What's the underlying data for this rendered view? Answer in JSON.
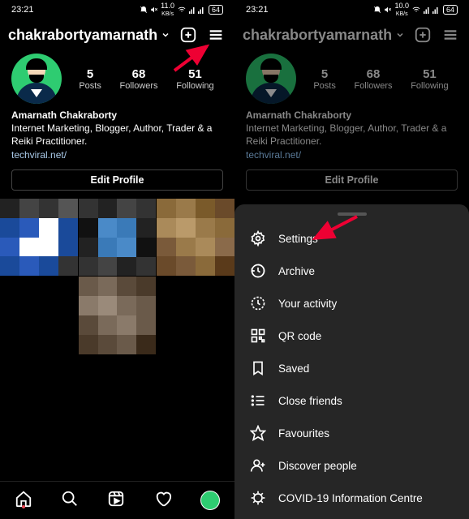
{
  "status": {
    "time": "23:21",
    "battery": "64",
    "net1": "11.0",
    "net2": "10.0",
    "unit": "KB/s"
  },
  "profile": {
    "username": "chakrabortyamarnath",
    "display_name": "Amarnath Chakraborty",
    "bio_line": "Internet Marketing, Blogger, Author, Trader & a Reiki Practitioner.",
    "link": "techviral.net/",
    "stats": {
      "posts": {
        "count": "5",
        "label": "Posts"
      },
      "followers": {
        "count": "68",
        "label": "Followers"
      },
      "following": {
        "count": "51",
        "label": "Following"
      }
    },
    "edit_label": "Edit Profile"
  },
  "menu": {
    "settings": "Settings",
    "archive": "Archive",
    "activity": "Your activity",
    "qr": "QR code",
    "saved": "Saved",
    "close": "Close friends",
    "fav": "Favourites",
    "discover": "Discover people",
    "covid": "COVID-19 Information Centre"
  },
  "icons": {
    "chevron": "chevron-down-icon",
    "create": "plus-square-icon",
    "menu": "hamburger-icon",
    "home": "home-icon",
    "search": "search-icon",
    "reels": "reels-icon",
    "heart": "heart-icon",
    "settings": "gear-icon",
    "archive": "clock-icon",
    "activity": "clock-dashed-icon",
    "qr": "qr-icon",
    "saved": "bookmark-icon",
    "close": "list-icon",
    "fav": "star-icon",
    "discover": "add-user-icon",
    "covid": "info-icon"
  }
}
